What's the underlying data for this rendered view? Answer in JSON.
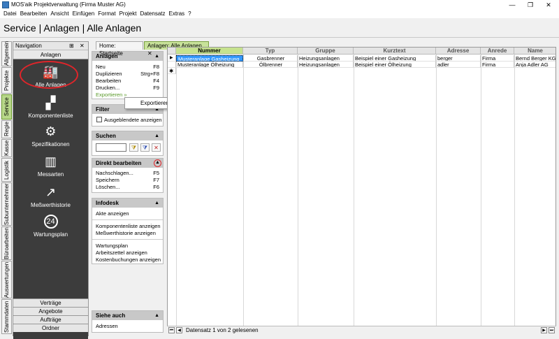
{
  "window": {
    "title": "MOS'aik Projektverwaltung (Firma Muster AG)",
    "min": "—",
    "restore": "❐",
    "close": "✕"
  },
  "menu": [
    "Datei",
    "Bearbeiten",
    "Ansicht",
    "Einfügen",
    "Format",
    "Projekt",
    "Datensatz",
    "Extras",
    "?"
  ],
  "page_title": "Service | Anlagen | Alle Anlagen",
  "vertical_tabs": [
    "Allgemein",
    "Projekte",
    "Service",
    "Regie",
    "Kasse",
    "Logistik",
    "Subunternehmer",
    "Büroarbeiten",
    "Auswertungen",
    "Stammdaten"
  ],
  "navigation": {
    "title": "Navigation",
    "pin": "⊞",
    "close": "✕",
    "section": "Anlagen",
    "items": [
      {
        "label": "Alle Anlagen",
        "icon": "🏭"
      },
      {
        "label": "Komponentenliste",
        "icon": "▞"
      },
      {
        "label": "Spezifikationen",
        "icon": "⚙"
      },
      {
        "label": "Messarten",
        "icon": "▥"
      },
      {
        "label": "Meßwerthistorie",
        "icon": "↗"
      },
      {
        "label": "Wartungsplan",
        "icon": "24"
      }
    ],
    "bottom": [
      "Verträge",
      "Angebote",
      "Aufträge",
      "Ordner"
    ]
  },
  "tasks": {
    "anlagen": {
      "title": "Anlagen",
      "rows": [
        {
          "label": "Neu",
          "key": "F8"
        },
        {
          "label": "Duplizieren",
          "key": "Strg+F8"
        },
        {
          "label": "Bearbeiten",
          "key": "F4"
        },
        {
          "label": "Drucken...",
          "key": "F9"
        }
      ],
      "export": "Exportieren »"
    },
    "filter": {
      "title": "Filter",
      "checkbox": "Ausgeblendete anzeigen"
    },
    "suchen": {
      "title": "Suchen",
      "placeholder": ""
    },
    "direkt": {
      "title": "Direkt bearbeiten",
      "rows": [
        {
          "label": "Nachschlagen...",
          "key": "F5"
        },
        {
          "label": "Speichern",
          "key": "F7"
        },
        {
          "label": "Löschen...",
          "key": "F6"
        }
      ]
    },
    "infodesk": {
      "title": "Infodesk",
      "rows": [
        "Akte anzeigen",
        "Komponentenliste anzeigen",
        "Meßwerthistorie anzeigen",
        "Wartungsplan",
        "Arbeitszettel anzeigen",
        "Kostenbuchungen anzeigen"
      ]
    },
    "siehe": {
      "title": "Siehe auch",
      "rows": [
        "Adressen"
      ]
    }
  },
  "context_menu": {
    "item": "Exportieren in eine CSV Datei..."
  },
  "doc_tabs": [
    {
      "label": "Home: Startseite"
    },
    {
      "label": "Anlagen: Alle Anlagen",
      "close": "✕"
    }
  ],
  "grid": {
    "columns": [
      "Nummer",
      "Typ",
      "Gruppe",
      "Kurztext",
      "Adresse",
      "Anrede",
      "Name"
    ],
    "rows": [
      [
        "Musteranlage Gasheizung",
        "Gasbrenner",
        "Heizungsanlagen",
        "Beispiel einer Gasheizung",
        "berger",
        "Firma",
        "Bernd Berger KG"
      ],
      [
        "Musteranlage Ölheizung",
        "Ölbrenner",
        "Heizungsanlagen",
        "Beispiel einer Ölheizung",
        "adler",
        "Firma",
        "Anja Adler AG"
      ]
    ],
    "new_row_marker": "✱",
    "current_row_marker": "▶"
  },
  "status": {
    "text": "Datensatz 1 von 2 gelesenen",
    "first": "⏮",
    "prev": "◀",
    "next": "▶",
    "last": "⏭"
  }
}
